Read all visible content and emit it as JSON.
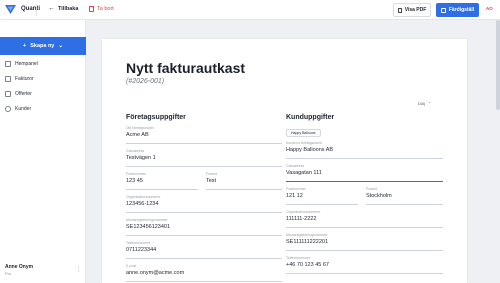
{
  "topbar": {
    "brand": "Quanti",
    "back_label": "Tillbaka",
    "delete_label": "Ta bort",
    "view_pdf_label": "Visa PDF",
    "finish_label": "Färdigställ",
    "avatar_initials": "AO"
  },
  "sidebar": {
    "create_label": "Skapa ny",
    "items": [
      {
        "label": "Hempanel"
      },
      {
        "label": "Fakturor"
      },
      {
        "label": "Offerter"
      },
      {
        "label": "Kunder"
      }
    ],
    "user": {
      "name": "Anne Onym",
      "plan": "Pro"
    }
  },
  "document": {
    "title": "Nytt fakturautkast",
    "number": "(#2026-001)",
    "collapse_label": "Dölj",
    "company": {
      "title": "Företagsuppgifter",
      "fields": {
        "name": {
          "label": "Ditt företagsnamn",
          "value": "Acme AB"
        },
        "address": {
          "label": "Gatuadress",
          "value": "Testvägen 1"
        },
        "zip": {
          "label": "Postnummer",
          "value": "123 45"
        },
        "city": {
          "label": "Postort",
          "value": "Test"
        },
        "org_number": {
          "label": "Organisationsnummer",
          "value": "123456-1234"
        },
        "vat_number": {
          "label": "Momsregistreringsnummer",
          "value": "SE123456123401"
        },
        "phone": {
          "label": "Telefonnummer",
          "value": "0711223344"
        },
        "email": {
          "label": "E-post",
          "value": "anne.onym@acme.com"
        }
      }
    },
    "customer": {
      "title": "Kunduppgifter",
      "chip_label": "Happy Balloons",
      "fields": {
        "name": {
          "label": "Kundens företagsnamn",
          "value": "Happy Balloons AB"
        },
        "address": {
          "label": "Gatuadress",
          "value": "Vasagatan 111"
        },
        "zip": {
          "label": "Postnummer",
          "value": "121 12"
        },
        "city": {
          "label": "Postort",
          "value": "Stockholm"
        },
        "org_number": {
          "label": "Organisationsnummer",
          "value": "111111-2222"
        },
        "vat_number": {
          "label": "Momsregistreringsnummer",
          "value": "SE111111222201"
        },
        "phone": {
          "label": "Telefonnummer",
          "value": "+46 70 123 45 67"
        }
      }
    }
  },
  "colors": {
    "accent": "#2f6fe4",
    "danger": "#d64848"
  }
}
